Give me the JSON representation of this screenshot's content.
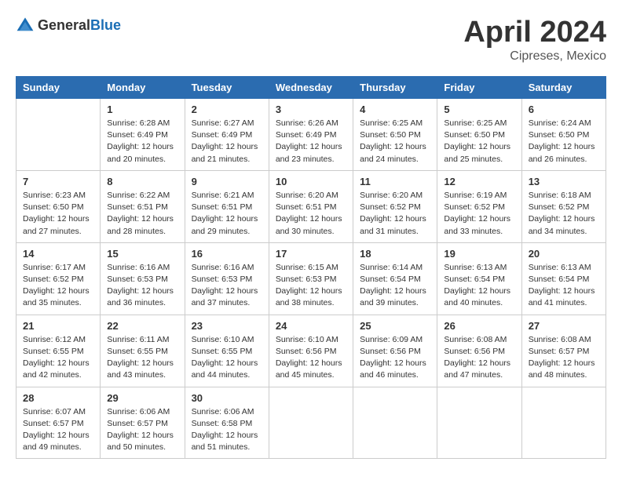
{
  "header": {
    "logo_general": "General",
    "logo_blue": "Blue",
    "month_year": "April 2024",
    "location": "Cipreses, Mexico"
  },
  "days_of_week": [
    "Sunday",
    "Monday",
    "Tuesday",
    "Wednesday",
    "Thursday",
    "Friday",
    "Saturday"
  ],
  "weeks": [
    [
      {
        "day": "",
        "sunrise": "",
        "sunset": "",
        "daylight": ""
      },
      {
        "day": "1",
        "sunrise": "Sunrise: 6:28 AM",
        "sunset": "Sunset: 6:49 PM",
        "daylight": "Daylight: 12 hours and 20 minutes."
      },
      {
        "day": "2",
        "sunrise": "Sunrise: 6:27 AM",
        "sunset": "Sunset: 6:49 PM",
        "daylight": "Daylight: 12 hours and 21 minutes."
      },
      {
        "day": "3",
        "sunrise": "Sunrise: 6:26 AM",
        "sunset": "Sunset: 6:49 PM",
        "daylight": "Daylight: 12 hours and 23 minutes."
      },
      {
        "day": "4",
        "sunrise": "Sunrise: 6:25 AM",
        "sunset": "Sunset: 6:50 PM",
        "daylight": "Daylight: 12 hours and 24 minutes."
      },
      {
        "day": "5",
        "sunrise": "Sunrise: 6:25 AM",
        "sunset": "Sunset: 6:50 PM",
        "daylight": "Daylight: 12 hours and 25 minutes."
      },
      {
        "day": "6",
        "sunrise": "Sunrise: 6:24 AM",
        "sunset": "Sunset: 6:50 PM",
        "daylight": "Daylight: 12 hours and 26 minutes."
      }
    ],
    [
      {
        "day": "7",
        "sunrise": "Sunrise: 6:23 AM",
        "sunset": "Sunset: 6:50 PM",
        "daylight": "Daylight: 12 hours and 27 minutes."
      },
      {
        "day": "8",
        "sunrise": "Sunrise: 6:22 AM",
        "sunset": "Sunset: 6:51 PM",
        "daylight": "Daylight: 12 hours and 28 minutes."
      },
      {
        "day": "9",
        "sunrise": "Sunrise: 6:21 AM",
        "sunset": "Sunset: 6:51 PM",
        "daylight": "Daylight: 12 hours and 29 minutes."
      },
      {
        "day": "10",
        "sunrise": "Sunrise: 6:20 AM",
        "sunset": "Sunset: 6:51 PM",
        "daylight": "Daylight: 12 hours and 30 minutes."
      },
      {
        "day": "11",
        "sunrise": "Sunrise: 6:20 AM",
        "sunset": "Sunset: 6:52 PM",
        "daylight": "Daylight: 12 hours and 31 minutes."
      },
      {
        "day": "12",
        "sunrise": "Sunrise: 6:19 AM",
        "sunset": "Sunset: 6:52 PM",
        "daylight": "Daylight: 12 hours and 33 minutes."
      },
      {
        "day": "13",
        "sunrise": "Sunrise: 6:18 AM",
        "sunset": "Sunset: 6:52 PM",
        "daylight": "Daylight: 12 hours and 34 minutes."
      }
    ],
    [
      {
        "day": "14",
        "sunrise": "Sunrise: 6:17 AM",
        "sunset": "Sunset: 6:52 PM",
        "daylight": "Daylight: 12 hours and 35 minutes."
      },
      {
        "day": "15",
        "sunrise": "Sunrise: 6:16 AM",
        "sunset": "Sunset: 6:53 PM",
        "daylight": "Daylight: 12 hours and 36 minutes."
      },
      {
        "day": "16",
        "sunrise": "Sunrise: 6:16 AM",
        "sunset": "Sunset: 6:53 PM",
        "daylight": "Daylight: 12 hours and 37 minutes."
      },
      {
        "day": "17",
        "sunrise": "Sunrise: 6:15 AM",
        "sunset": "Sunset: 6:53 PM",
        "daylight": "Daylight: 12 hours and 38 minutes."
      },
      {
        "day": "18",
        "sunrise": "Sunrise: 6:14 AM",
        "sunset": "Sunset: 6:54 PM",
        "daylight": "Daylight: 12 hours and 39 minutes."
      },
      {
        "day": "19",
        "sunrise": "Sunrise: 6:13 AM",
        "sunset": "Sunset: 6:54 PM",
        "daylight": "Daylight: 12 hours and 40 minutes."
      },
      {
        "day": "20",
        "sunrise": "Sunrise: 6:13 AM",
        "sunset": "Sunset: 6:54 PM",
        "daylight": "Daylight: 12 hours and 41 minutes."
      }
    ],
    [
      {
        "day": "21",
        "sunrise": "Sunrise: 6:12 AM",
        "sunset": "Sunset: 6:55 PM",
        "daylight": "Daylight: 12 hours and 42 minutes."
      },
      {
        "day": "22",
        "sunrise": "Sunrise: 6:11 AM",
        "sunset": "Sunset: 6:55 PM",
        "daylight": "Daylight: 12 hours and 43 minutes."
      },
      {
        "day": "23",
        "sunrise": "Sunrise: 6:10 AM",
        "sunset": "Sunset: 6:55 PM",
        "daylight": "Daylight: 12 hours and 44 minutes."
      },
      {
        "day": "24",
        "sunrise": "Sunrise: 6:10 AM",
        "sunset": "Sunset: 6:56 PM",
        "daylight": "Daylight: 12 hours and 45 minutes."
      },
      {
        "day": "25",
        "sunrise": "Sunrise: 6:09 AM",
        "sunset": "Sunset: 6:56 PM",
        "daylight": "Daylight: 12 hours and 46 minutes."
      },
      {
        "day": "26",
        "sunrise": "Sunrise: 6:08 AM",
        "sunset": "Sunset: 6:56 PM",
        "daylight": "Daylight: 12 hours and 47 minutes."
      },
      {
        "day": "27",
        "sunrise": "Sunrise: 6:08 AM",
        "sunset": "Sunset: 6:57 PM",
        "daylight": "Daylight: 12 hours and 48 minutes."
      }
    ],
    [
      {
        "day": "28",
        "sunrise": "Sunrise: 6:07 AM",
        "sunset": "Sunset: 6:57 PM",
        "daylight": "Daylight: 12 hours and 49 minutes."
      },
      {
        "day": "29",
        "sunrise": "Sunrise: 6:06 AM",
        "sunset": "Sunset: 6:57 PM",
        "daylight": "Daylight: 12 hours and 50 minutes."
      },
      {
        "day": "30",
        "sunrise": "Sunrise: 6:06 AM",
        "sunset": "Sunset: 6:58 PM",
        "daylight": "Daylight: 12 hours and 51 minutes."
      },
      {
        "day": "",
        "sunrise": "",
        "sunset": "",
        "daylight": ""
      },
      {
        "day": "",
        "sunrise": "",
        "sunset": "",
        "daylight": ""
      },
      {
        "day": "",
        "sunrise": "",
        "sunset": "",
        "daylight": ""
      },
      {
        "day": "",
        "sunrise": "",
        "sunset": "",
        "daylight": ""
      }
    ]
  ]
}
